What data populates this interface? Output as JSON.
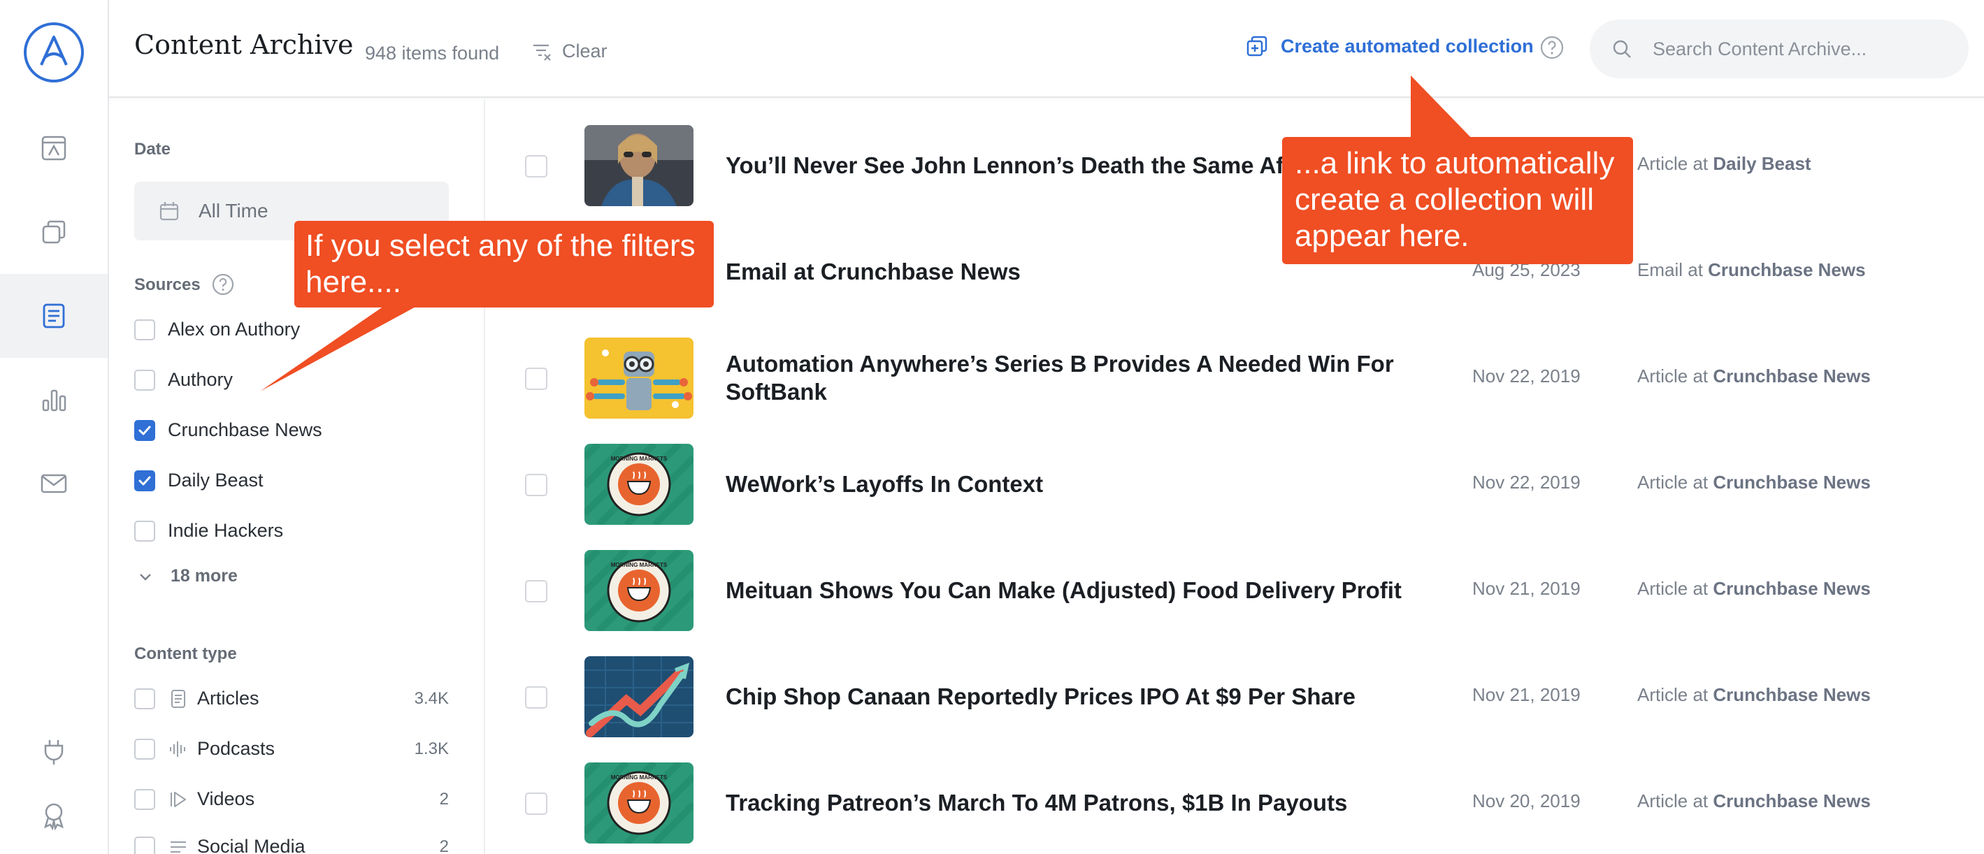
{
  "header": {
    "title": "Content Archive",
    "items_count": "948 items found",
    "clear_label": "Clear",
    "create_collection_label": "Create automated collection",
    "search_placeholder": "Search Content Archive..."
  },
  "filters": {
    "date_label": "Date",
    "date_value": "All Time",
    "sources_label": "Sources",
    "sources": [
      {
        "label": "Alex on Authory",
        "checked": false
      },
      {
        "label": "Authory",
        "checked": false
      },
      {
        "label": "Crunchbase News",
        "checked": true
      },
      {
        "label": "Daily Beast",
        "checked": true
      },
      {
        "label": "Indie Hackers",
        "checked": false
      }
    ],
    "more_label": "18 more",
    "content_type_label": "Content type",
    "content_types": [
      {
        "label": "Articles",
        "count": "3.4K",
        "icon": "document-icon"
      },
      {
        "label": "Podcasts",
        "count": "1.3K",
        "icon": "audio-wave-icon"
      },
      {
        "label": "Videos",
        "count": "2",
        "icon": "play-icon"
      },
      {
        "label": "Social Media",
        "count": "2",
        "icon": "lines-icon"
      }
    ]
  },
  "items": [
    {
      "title": "You’ll Never See John Lennon’s Death the Same Afte",
      "date": "",
      "type": "Article at",
      "source": "Daily Beast",
      "thumb": "photo"
    },
    {
      "title": "Email at Crunchbase News",
      "date": "Aug 25, 2023",
      "type": "Email at",
      "source": "Crunchbase News",
      "thumb": "none"
    },
    {
      "title": "Automation Anywhere’s Series B Provides A Needed Win For SoftBank",
      "date": "Nov 22, 2019",
      "type": "Article at",
      "source": "Crunchbase News",
      "thumb": "robot"
    },
    {
      "title": "WeWork’s Layoffs In Context",
      "date": "Nov 22, 2019",
      "type": "Article at",
      "source": "Crunchbase News",
      "thumb": "morning-markets"
    },
    {
      "title": "Meituan Shows You Can Make (Adjusted) Food Delivery Profit",
      "date": "Nov 21, 2019",
      "type": "Article at",
      "source": "Crunchbase News",
      "thumb": "morning-markets"
    },
    {
      "title": "Chip Shop Canaan Reportedly Prices IPO At $9 Per Share",
      "date": "Nov 21, 2019",
      "type": "Article at",
      "source": "Crunchbase News",
      "thumb": "chart"
    },
    {
      "title": "Tracking Patreon’s March To 4M Patrons, $1B In Payouts",
      "date": "Nov 20, 2019",
      "type": "Article at",
      "source": "Crunchbase News",
      "thumb": "morning-markets"
    }
  ],
  "thumb_logo_text": "MORNING MARKETS",
  "callouts": {
    "filters": "If you select any of the filters here....",
    "collection": "...a link to automatically create a collection will appear here."
  },
  "colors": {
    "accent": "#2f6fd6",
    "callout": "#f04e23",
    "active_nav": "#f1f2f4"
  }
}
